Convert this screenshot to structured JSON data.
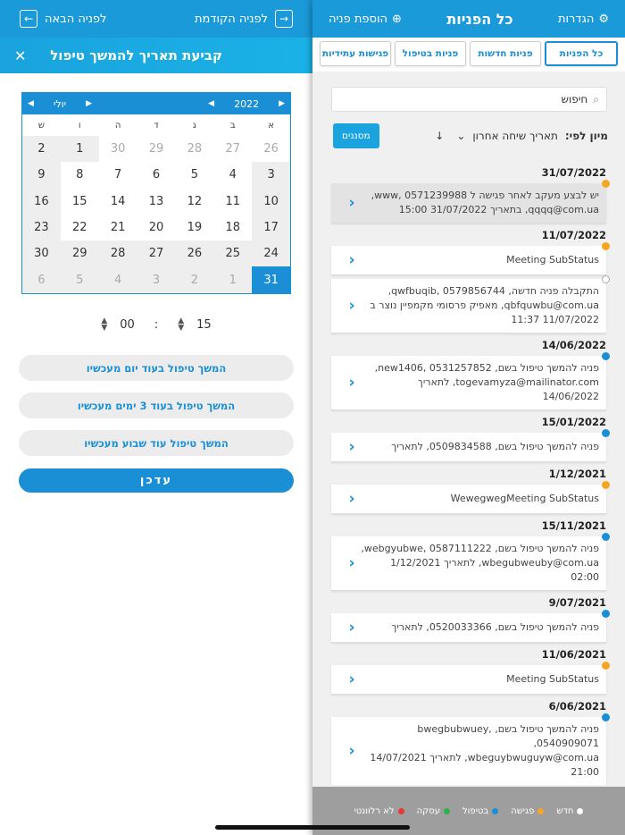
{
  "left": {
    "topbar": {
      "next": "לפניה הבאה",
      "prev": "לפניה הקודמת"
    },
    "dialog": {
      "title": "קביעת תאריך להמשך טיפול",
      "close": "✕"
    },
    "calendar": {
      "month": "יולי",
      "year": "2022",
      "weekdays": [
        "א",
        "ב",
        "ג",
        "ד",
        "ה",
        "ו",
        "ש"
      ],
      "weeks": [
        [
          "26",
          "27",
          "28",
          "29",
          "30",
          "1",
          "2"
        ],
        [
          "3",
          "4",
          "5",
          "6",
          "7",
          "8",
          "9"
        ],
        [
          "10",
          "11",
          "12",
          "13",
          "14",
          "15",
          "16"
        ],
        [
          "17",
          "18",
          "19",
          "20",
          "21",
          "22",
          "23"
        ],
        [
          "24",
          "25",
          "26",
          "27",
          "28",
          "29",
          "30"
        ],
        [
          "31",
          "1",
          "2",
          "3",
          "4",
          "5",
          "6"
        ]
      ],
      "selected": "31"
    },
    "time": {
      "hour": "15",
      "minute": "00",
      "sep": ":"
    },
    "quick": [
      "המשך טיפול בעוד יום מעכשיו",
      "המשך טיפול בעוד 3 ימים מעכשיו",
      "המשך טיפול עוד שבוע מעכשיו"
    ],
    "update": "עדכן"
  },
  "right": {
    "topbar": {
      "settings": "הגדרות",
      "title": "כל הפניות",
      "add": "הוספת פניה"
    },
    "tabs": [
      "כל הפניות",
      "פניות חדשות",
      "פניות בטיפול",
      "פגישות עתידיות"
    ],
    "search": {
      "placeholder": "חיפוש"
    },
    "sort": {
      "label": "מיון לפי:",
      "value": "תאריך שיחה אחרון",
      "filter": "מסננים"
    },
    "groups": [
      {
        "date": "31/07/2022",
        "items": [
          {
            "lines": [
              "יש לבצע מעקב לאחר פגישה ל www, 0571239988,",
              "qqqq@com.ua, בתאריך 31/07/2022 15:00"
            ],
            "dot": "#f5a623",
            "hl": true
          }
        ]
      },
      {
        "date": "11/07/2022",
        "items": [
          {
            "lines": [
              "Meeting SubStatus"
            ],
            "dot": "#f5a623",
            "hl": false
          },
          {
            "lines": [
              "התקבלה פניה חדשה, qwfbuqib, 0579856744,",
              "qbfquwbu@com.ua, מאפיק פרסומי מקמפיין נוצר ב",
              "11/07/2022 11:37"
            ],
            "dot": "#ffffff",
            "hl": false
          }
        ]
      },
      {
        "date": "14/06/2022",
        "items": [
          {
            "lines": [
              "פניה להמשך טיפול בשם, new1406, 0531257852,",
              "togevamyza@mailinator.com, לתאריך 14/06/2022"
            ],
            "dot": "#1a8fd6",
            "hl": false
          }
        ]
      },
      {
        "date": "15/01/2022",
        "items": [
          {
            "lines": [
              "פניה להמשך טיפול בשם, 0509834588, לתאריך"
            ],
            "dot": "#1a8fd6",
            "hl": false
          }
        ]
      },
      {
        "date": "1/12/2021",
        "items": [
          {
            "lines": [
              "WewegwegMeeting SubStatus"
            ],
            "dot": "#f5a623",
            "hl": false
          }
        ]
      },
      {
        "date": "15/11/2021",
        "items": [
          {
            "lines": [
              "פניה להמשך טיפול בשם, webgyubwe, 0587111222,",
              "wbegubweuby@com.ua, לתאריך 1/12/2021 02:00"
            ],
            "dot": "#1a8fd6",
            "hl": false
          }
        ]
      },
      {
        "date": "9/07/2021",
        "items": [
          {
            "lines": [
              "פניה להמשך טיפול בשם, 0520033366, לתאריך"
            ],
            "dot": "#1a8fd6",
            "hl": false
          }
        ]
      },
      {
        "date": "11/06/2021",
        "items": [
          {
            "lines": [
              "Meeting SubStatus"
            ],
            "dot": "#f5a623",
            "hl": false
          }
        ]
      },
      {
        "date": "6/06/2021",
        "items": [
          {
            "lines": [
              "פניה להמשך טיפול בשם, bwegbubwuey, 0540909071,",
              "wbeguybwuguyw@com.ua, לתאריך 14/07/2021 21:00"
            ],
            "dot": "#1a8fd6",
            "hl": false
          }
        ]
      }
    ],
    "legend": [
      {
        "label": "חדש",
        "color": "#ffffff"
      },
      {
        "label": "פגישה",
        "color": "#f5a623"
      },
      {
        "label": "בטיפול",
        "color": "#1a8fd6"
      },
      {
        "label": "עסקה",
        "color": "#2bb24c"
      },
      {
        "label": "לא רלוונטי",
        "color": "#e53935"
      }
    ]
  }
}
